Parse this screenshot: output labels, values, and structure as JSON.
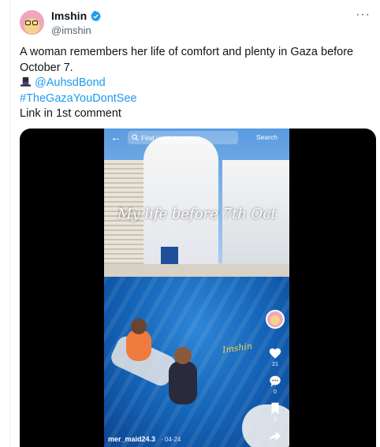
{
  "author": {
    "name": "Imshin",
    "handle": "@imshin",
    "verified": true
  },
  "icons": {
    "more": "more-options-icon",
    "verified": "verified-badge-icon",
    "hat": "top-hat-icon",
    "back": "back-arrow-icon",
    "search": "search-icon",
    "like": "heart-icon",
    "comment": "comment-icon",
    "bookmark": "bookmark-icon",
    "share": "share-icon"
  },
  "post": {
    "line1": "A woman remembers her life of comfort and plenty in Gaza before",
    "line2": "October 7.",
    "mention": "@AuhsdBond",
    "hashtag": "#TheGazaYouDontSee",
    "line5": "Link in 1st comment"
  },
  "video": {
    "search_placeholder": "Find related content",
    "search_button": "Search",
    "overlay_text": "My life before 7th Oct",
    "watermark": "Imshin",
    "like_count": "21",
    "comment_count": "0",
    "bookmark_count": "2",
    "username": "mer_maid24.3",
    "date": "· 04-24"
  },
  "colors": {
    "link": "#1d9bf0",
    "verified": "#1d9bf0",
    "secondary_text": "#536471"
  }
}
